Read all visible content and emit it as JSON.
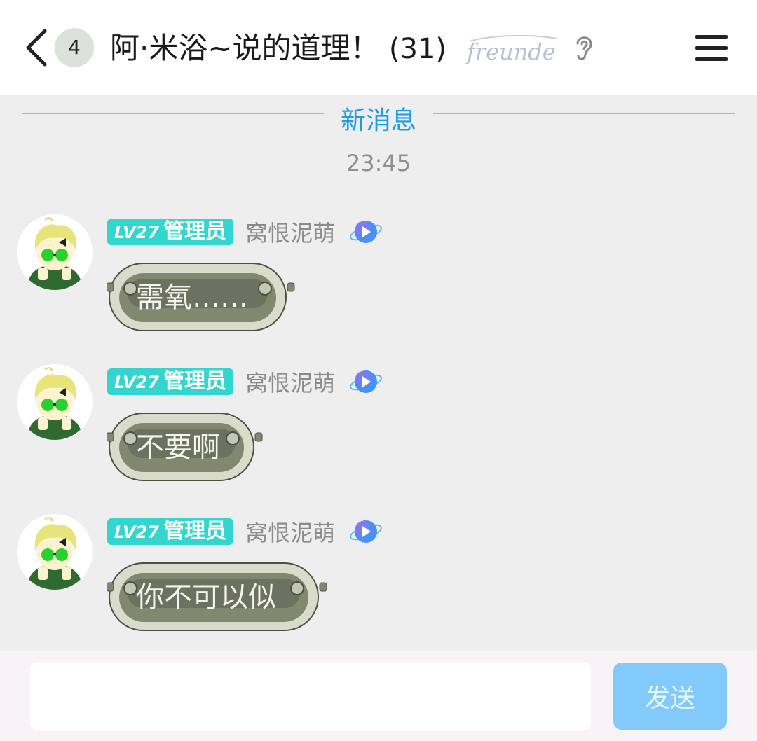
{
  "header": {
    "unread_count": "4",
    "title": "阿·米浴~说的道理！",
    "member_count": "(31)",
    "brand_logo_text": "freunde",
    "back_icon": "chevron-left-icon",
    "ear_icon": "ear-icon",
    "menu_icon": "menu-icon"
  },
  "divider": {
    "label": "新消息"
  },
  "timestamp": "23:45",
  "messages": [
    {
      "level": "LV27",
      "role": "管理员",
      "sender": "窝恨泥萌",
      "text": "需氧……"
    },
    {
      "level": "LV27",
      "role": "管理员",
      "sender": "窝恨泥萌",
      "text": "不要啊"
    },
    {
      "level": "LV27",
      "role": "管理员",
      "sender": "窝恨泥萌",
      "text": "你不可以似"
    }
  ],
  "composer": {
    "input_value": "",
    "send_label": "发送"
  },
  "colors": {
    "accent": "#1c9be6",
    "role_badge": "#33d6cf",
    "send_button": "#82cafb"
  }
}
